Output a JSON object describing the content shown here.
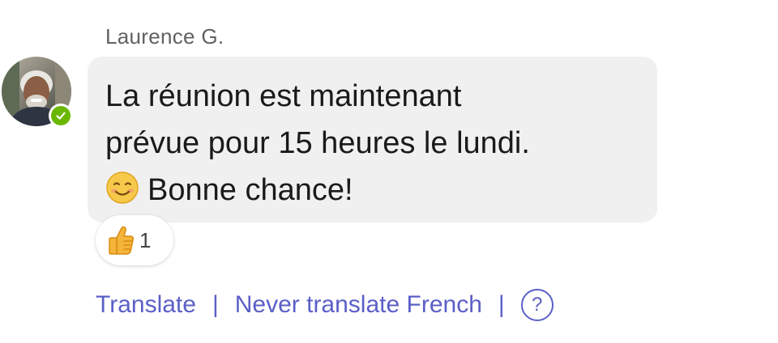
{
  "message": {
    "sender_name": "Laurence G.",
    "presence": "available",
    "lines": [
      "La réunion est maintenant",
      "prévue pour 15 heures le lundi.",
      "Bonne chance!"
    ],
    "emoji": "smiling-face-icon"
  },
  "reaction": {
    "emoji": "thumbs-up-icon",
    "count": "1"
  },
  "translation": {
    "translate_label": "Translate",
    "separator": "|",
    "never_translate_label": "Never translate French",
    "help_label": "?"
  },
  "colors": {
    "bubble": "#f0f0f0",
    "link": "#5b5fc7",
    "presence": "#6bb700",
    "sender": "#616161"
  }
}
